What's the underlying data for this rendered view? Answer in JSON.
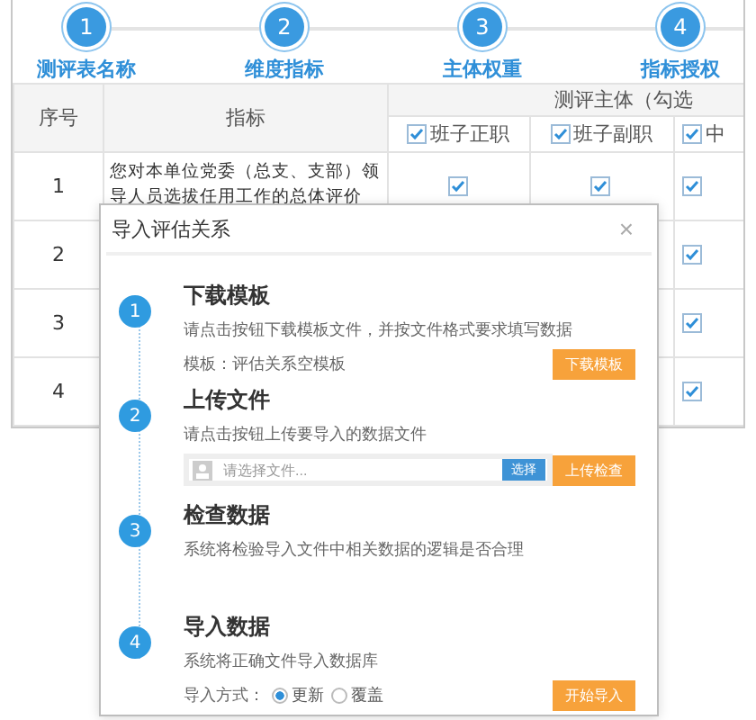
{
  "wizard_steps": [
    {
      "number": "1",
      "label": "测评表名称"
    },
    {
      "number": "2",
      "label": "维度指标"
    },
    {
      "number": "3",
      "label": "主体权重"
    },
    {
      "number": "4",
      "label": "指标授权"
    }
  ],
  "table": {
    "col_number": "序号",
    "col_indicator": "指标",
    "group_header": "测评主体（勾选",
    "subjects": [
      {
        "label": "班子正职",
        "checked": true
      },
      {
        "label": "班子副职",
        "checked": true
      },
      {
        "label": "中",
        "checked": true
      }
    ],
    "rows": [
      {
        "number": "1",
        "indicator": "您对本单位党委（总支、支部）领导人员选拔任用工作的总体评价",
        "checks": [
          {
            "checked": true
          },
          {
            "checked": true
          },
          {
            "checked": true
          }
        ]
      },
      {
        "number": "2",
        "checks": [
          {
            "checked": true
          }
        ]
      },
      {
        "number": "3",
        "checks": [
          {
            "checked": true
          }
        ]
      },
      {
        "number": "4",
        "checks": [
          {
            "checked": true
          }
        ]
      }
    ]
  },
  "dialog": {
    "title": "导入评估关系",
    "close": "×",
    "steps": [
      {
        "kind": "download",
        "number": "1",
        "title": "下载模板",
        "description": "请点击按钮下载模板文件，并按文件格式要求填写数据",
        "note": "模板：评估关系空模板",
        "button": "下载模板"
      },
      {
        "kind": "upload",
        "number": "2",
        "title": "上传文件",
        "description": "请点击按钮上传要导入的数据文件",
        "placeholder": "请选择文件...",
        "choose": "选择",
        "button": "上传检查"
      },
      {
        "kind": "check",
        "number": "3",
        "title": "检查数据",
        "description": "系统将检验导入文件中相关数据的逻辑是否合理"
      },
      {
        "kind": "import",
        "number": "4",
        "title": "导入数据",
        "description": "系统将正确文件导入数据库",
        "mode_label": "导入方式：",
        "modes": [
          {
            "label": "更新",
            "selected": true
          },
          {
            "label": "覆盖",
            "selected": false
          }
        ],
        "button": "开始导入"
      }
    ]
  }
}
